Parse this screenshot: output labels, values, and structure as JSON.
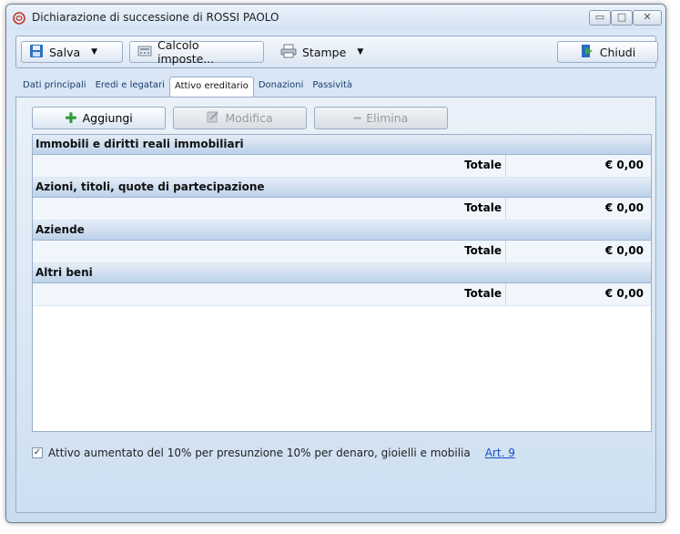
{
  "window": {
    "title": "Dichiarazione di successione di ROSSI PAOLO"
  },
  "toolbar": {
    "salva": "Salva",
    "calcolo": "Calcolo imposte...",
    "stampe": "Stampe",
    "chiudi": "Chiudi"
  },
  "tabs": [
    {
      "label": "Dati principali"
    },
    {
      "label": "Eredi e legatari"
    },
    {
      "label": "Attivo ereditario"
    },
    {
      "label": "Donazioni"
    },
    {
      "label": "Passività"
    }
  ],
  "actions": {
    "aggiungi": "Aggiungi",
    "modifica": "Modifica",
    "elimina": "Elimina"
  },
  "categories": [
    {
      "name": "Immobili e diritti reali immobiliari",
      "total_label": "Totale",
      "total": "€ 0,00"
    },
    {
      "name": "Azioni, titoli, quote di partecipazione",
      "total_label": "Totale",
      "total": "€ 0,00"
    },
    {
      "name": "Aziende",
      "total_label": "Totale",
      "total": "€ 0,00"
    },
    {
      "name": "Altri beni",
      "total_label": "Totale",
      "total": "€ 0,00"
    }
  ],
  "footer": {
    "checkbox_label": "Attivo aumentato del 10% per presunzione 10% per denaro, gioielli e mobilia",
    "checked": true,
    "link": "Art. 9"
  }
}
